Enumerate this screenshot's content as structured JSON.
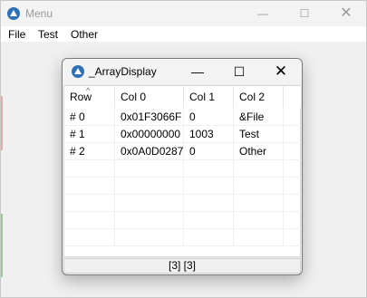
{
  "background_window": {
    "title": "Menu",
    "menu": [
      "File",
      "Test",
      "Other"
    ],
    "minimize_glyph": "—",
    "maximize_glyph": "☐",
    "close_glyph": "✕"
  },
  "array_display": {
    "title": "_ArrayDisplay",
    "minimize_glyph": "—",
    "maximize_glyph": "☐",
    "close_glyph": "✕",
    "columns": [
      "Row",
      "Col 0",
      "Col 1",
      "Col 2"
    ],
    "sort_indicator": "^",
    "rows": [
      [
        "# 0",
        "0x01F3066F",
        "0",
        "&File"
      ],
      [
        "# 1",
        "0x00000000",
        "1003",
        "Test"
      ],
      [
        "# 2",
        "0x0A0D0287",
        "0",
        "Other"
      ]
    ],
    "status": "[3] [3]"
  },
  "colors": {
    "app_icon": "#2f6fb5",
    "edge_green": "#3a9a3a",
    "edge_red": "#c03030"
  }
}
